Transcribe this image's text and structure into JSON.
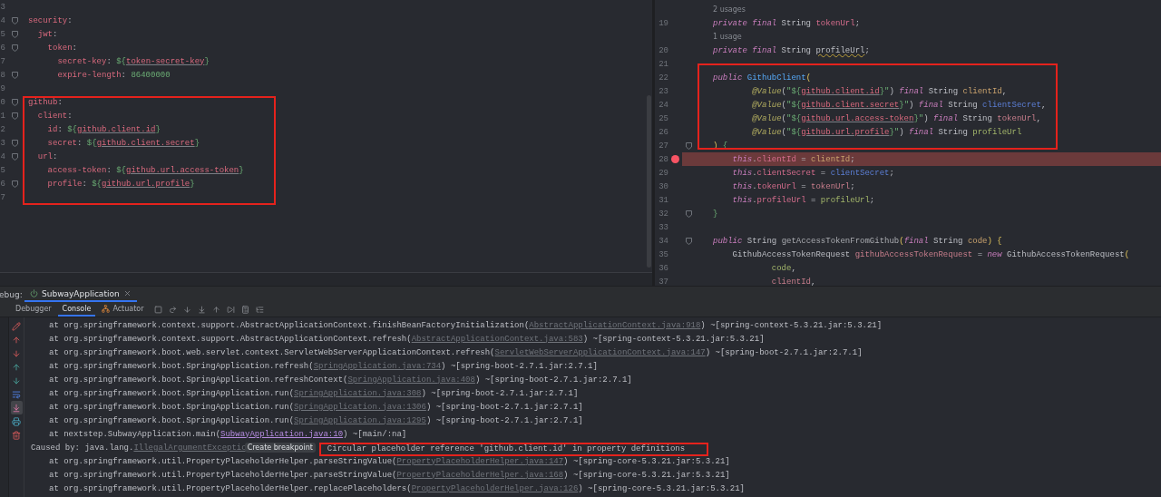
{
  "yaml_editor": {
    "lines": [
      {
        "number": "3",
        "fold": false
      },
      {
        "number": "4",
        "fold": true,
        "tokens": [
          {
            "text": "security",
            "kind": "key"
          },
          {
            "text": ":",
            "kind": "punct"
          }
        ],
        "children": [
          {
            "number": "5",
            "fold": true,
            "tokens": [
              {
                "text": "jwt",
                "kind": "key"
              },
              {
                "text": ":",
                "kind": "punct"
              }
            ],
            "children": [
              {
                "number": "6",
                "fold": true,
                "tokens": [
                  {
                    "text": "token",
                    "kind": "key"
                  },
                  {
                    "text": ":",
                    "kind": "punct"
                  }
                ],
                "children": [
                  {
                    "number": "7",
                    "fold": false,
                    "tokens": [
                      {
                        "text": "secret-key",
                        "kind": "key"
                      },
                      {
                        "text": ": ",
                        "kind": "punct"
                      },
                      {
                        "text": "${",
                        "kind": "string"
                      },
                      {
                        "text": "token-secret-key",
                        "kind": "ref"
                      },
                      {
                        "text": "}",
                        "kind": "string"
                      }
                    ]
                  },
                  {
                    "number": "8",
                    "fold": true,
                    "tokens": [
                      {
                        "text": "expire-length",
                        "kind": "key"
                      },
                      {
                        "text": ": ",
                        "kind": "punct"
                      },
                      {
                        "text": "86400000",
                        "kind": "number"
                      }
                    ]
                  }
                ]
              }
            ]
          }
        ]
      },
      {
        "number": "9",
        "fold": false
      },
      {
        "number": "0",
        "fold": true,
        "framed": true,
        "tokens": [
          {
            "text": "github",
            "kind": "key"
          },
          {
            "text": ":",
            "kind": "punct"
          }
        ],
        "children": [
          {
            "number": "1",
            "fold": true,
            "tokens": [
              {
                "text": "client",
                "kind": "key"
              },
              {
                "text": ":",
                "kind": "punct"
              }
            ],
            "children": [
              {
                "number": "2",
                "fold": false,
                "tokens": [
                  {
                    "text": "id",
                    "kind": "key"
                  },
                  {
                    "text": ": ",
                    "kind": "punct"
                  },
                  {
                    "text": "${",
                    "kind": "string"
                  },
                  {
                    "text": "github.client.id",
                    "kind": "ref"
                  },
                  {
                    "text": "}",
                    "kind": "string"
                  }
                ]
              },
              {
                "number": "3",
                "fold": true,
                "tokens": [
                  {
                    "text": "secret",
                    "kind": "key"
                  },
                  {
                    "text": ": ",
                    "kind": "punct"
                  },
                  {
                    "text": "${",
                    "kind": "string"
                  },
                  {
                    "text": "github.client.secret",
                    "kind": "ref"
                  },
                  {
                    "text": "}",
                    "kind": "string"
                  }
                ]
              }
            ]
          },
          {
            "number": "4",
            "fold": true,
            "tokens": [
              {
                "text": "url",
                "kind": "key"
              },
              {
                "text": ":",
                "kind": "punct"
              }
            ],
            "children": [
              {
                "number": "5",
                "fold": false,
                "tokens": [
                  {
                    "text": "access-token",
                    "kind": "key"
                  },
                  {
                    "text": ": ",
                    "kind": "punct"
                  },
                  {
                    "text": "${",
                    "kind": "string"
                  },
                  {
                    "text": "github.url.access-token",
                    "kind": "ref"
                  },
                  {
                    "text": "}",
                    "kind": "string"
                  }
                ]
              },
              {
                "number": "6",
                "fold": true,
                "tokens": [
                  {
                    "text": "profile",
                    "kind": "key"
                  },
                  {
                    "text": ": ",
                    "kind": "punct"
                  },
                  {
                    "text": "${",
                    "kind": "string"
                  },
                  {
                    "text": "github.url.profile",
                    "kind": "ref"
                  },
                  {
                    "text": "}",
                    "kind": "string"
                  }
                ]
              }
            ]
          },
          {
            "number": "7",
            "fold": false
          }
        ]
      }
    ]
  },
  "java_editor": {
    "lines": [
      {
        "kind": "hint",
        "text": "2 usages"
      },
      {
        "kind": "code",
        "number": "19",
        "fold": false,
        "breakpoint": false,
        "tokens": [
          {
            "text": "private",
            "kind": "keyword"
          },
          {
            "text": " final",
            "kind": "keyword"
          },
          {
            "text": " String ",
            "kind": "type"
          },
          {
            "text": "tokenUrl",
            "kind": "field"
          },
          {
            "text": ";",
            "kind": "punct"
          }
        ]
      },
      {
        "kind": "hint",
        "text": "1 usage"
      },
      {
        "kind": "code",
        "number": "20",
        "fold": false,
        "breakpoint": false,
        "tokens": [
          {
            "text": "private",
            "kind": "keyword"
          },
          {
            "text": " final",
            "kind": "keyword"
          },
          {
            "text": " String ",
            "kind": "type"
          },
          {
            "text": "profileUrl",
            "kind": "warn"
          },
          {
            "text": ";",
            "kind": "punct"
          }
        ]
      },
      {
        "kind": "code",
        "number": "21",
        "fold": false,
        "breakpoint": false
      },
      {
        "kind": "code",
        "number": "22",
        "fold": false,
        "breakpoint": false,
        "framed": true,
        "tokens": [
          {
            "text": "public",
            "kind": "keyword"
          },
          {
            "text": " GithubClient",
            "kind": "func"
          },
          {
            "text": "(",
            "kind": "bracket"
          }
        ],
        "children": [
          {
            "kind": "code",
            "number": "23",
            "fold": false,
            "breakpoint": false,
            "tokens": [
              {
                "text": "@Value",
                "kind": "annotation"
              },
              {
                "text": "(",
                "kind": "punct"
              },
              {
                "text": "\"${",
                "kind": "string"
              },
              {
                "text": "github.client.id",
                "kind": "ref"
              },
              {
                "text": "}\"",
                "kind": "string"
              },
              {
                "text": ") ",
                "kind": "punct"
              },
              {
                "text": "final",
                "kind": "keyword"
              },
              {
                "text": " String ",
                "kind": "type"
              },
              {
                "text": "clientId",
                "kind": "ident1"
              },
              {
                "text": ",",
                "kind": "punct"
              }
            ]
          },
          {
            "kind": "code",
            "number": "24",
            "fold": false,
            "breakpoint": false,
            "tokens": [
              {
                "text": "@Value",
                "kind": "annotation"
              },
              {
                "text": "(",
                "kind": "punct"
              },
              {
                "text": "\"${",
                "kind": "string"
              },
              {
                "text": "github.client.secret",
                "kind": "ref"
              },
              {
                "text": "}\"",
                "kind": "string"
              },
              {
                "text": ") ",
                "kind": "punct"
              },
              {
                "text": "final",
                "kind": "keyword"
              },
              {
                "text": " String ",
                "kind": "type"
              },
              {
                "text": "clientSecret",
                "kind": "ident2"
              },
              {
                "text": ",",
                "kind": "punct"
              }
            ]
          },
          {
            "kind": "code",
            "number": "25",
            "fold": false,
            "breakpoint": false,
            "tokens": [
              {
                "text": "@Value",
                "kind": "annotation"
              },
              {
                "text": "(",
                "kind": "punct"
              },
              {
                "text": "\"${",
                "kind": "string"
              },
              {
                "text": "github.url.access-token",
                "kind": "ref"
              },
              {
                "text": "}\"",
                "kind": "string"
              },
              {
                "text": ") ",
                "kind": "punct"
              },
              {
                "text": "final",
                "kind": "keyword"
              },
              {
                "text": " String ",
                "kind": "type"
              },
              {
                "text": "tokenUrl",
                "kind": "ident3"
              },
              {
                "text": ",",
                "kind": "punct"
              }
            ]
          },
          {
            "kind": "code",
            "number": "26",
            "fold": false,
            "breakpoint": false,
            "tokens": [
              {
                "text": "@Value",
                "kind": "annotation"
              },
              {
                "text": "(",
                "kind": "punct"
              },
              {
                "text": "\"${",
                "kind": "string"
              },
              {
                "text": "github.url.profile",
                "kind": "ref"
              },
              {
                "text": "}\"",
                "kind": "string"
              },
              {
                "text": ") ",
                "kind": "punct"
              },
              {
                "text": "final",
                "kind": "keyword"
              },
              {
                "text": " String ",
                "kind": "type"
              },
              {
                "text": "profileUrl",
                "kind": "ident4"
              }
            ]
          }
        ]
      },
      {
        "kind": "code",
        "number": "27",
        "fold": true,
        "breakpoint": false,
        "tokens": [
          {
            "text": ")",
            "kind": "bracket"
          },
          {
            "text": " {",
            "kind": "brace"
          }
        ],
        "children": [
          {
            "kind": "code",
            "number": "28",
            "fold": false,
            "breakpoint": true,
            "tokens": [
              {
                "text": "this",
                "kind": "keyword"
              },
              {
                "text": ".",
                "kind": "punct"
              },
              {
                "text": "clientId",
                "kind": "field"
              },
              {
                "text": " = ",
                "kind": "punct"
              },
              {
                "text": "clientId",
                "kind": "ident1"
              },
              {
                "text": ";",
                "kind": "punct"
              }
            ]
          },
          {
            "kind": "code",
            "number": "29",
            "fold": false,
            "breakpoint": false,
            "tokens": [
              {
                "text": "this",
                "kind": "keyword"
              },
              {
                "text": ".",
                "kind": "punct"
              },
              {
                "text": "clientSecret",
                "kind": "field"
              },
              {
                "text": " = ",
                "kind": "punct"
              },
              {
                "text": "clientSecret",
                "kind": "ident2"
              },
              {
                "text": ";",
                "kind": "punct"
              }
            ]
          },
          {
            "kind": "code",
            "number": "30",
            "fold": false,
            "breakpoint": false,
            "tokens": [
              {
                "text": "this",
                "kind": "keyword"
              },
              {
                "text": ".",
                "kind": "punct"
              },
              {
                "text": "tokenUrl",
                "kind": "field"
              },
              {
                "text": " = ",
                "kind": "punct"
              },
              {
                "text": "tokenUrl",
                "kind": "ident3"
              },
              {
                "text": ";",
                "kind": "punct"
              }
            ]
          },
          {
            "kind": "code",
            "number": "31",
            "fold": false,
            "breakpoint": false,
            "tokens": [
              {
                "text": "this",
                "kind": "keyword"
              },
              {
                "text": ".",
                "kind": "punct"
              },
              {
                "text": "profileUrl",
                "kind": "field"
              },
              {
                "text": " = ",
                "kind": "punct"
              },
              {
                "text": "profileUrl",
                "kind": "ident4"
              },
              {
                "text": ";",
                "kind": "punct"
              }
            ]
          }
        ]
      },
      {
        "kind": "code",
        "number": "32",
        "fold": true,
        "breakpoint": false,
        "tokens": [
          {
            "text": "}",
            "kind": "brace"
          }
        ]
      },
      {
        "kind": "code",
        "number": "33",
        "fold": false,
        "breakpoint": false
      },
      {
        "kind": "code",
        "number": "34",
        "fold": true,
        "breakpoint": false,
        "tokens": [
          {
            "text": "public",
            "kind": "keyword"
          },
          {
            "text": " String ",
            "kind": "type"
          },
          {
            "text": "getAccessTokenFromGithub",
            "kind": "method"
          },
          {
            "text": "(",
            "kind": "bracket"
          },
          {
            "text": "final",
            "kind": "keyword"
          },
          {
            "text": " String ",
            "kind": "type"
          },
          {
            "text": "code",
            "kind": "ident1"
          },
          {
            "text": ")",
            "kind": "bracket"
          },
          {
            "text": " {",
            "kind": "brace2"
          }
        ],
        "children": [
          {
            "kind": "code",
            "number": "35",
            "fold": false,
            "breakpoint": false,
            "tokens": [
              {
                "text": "GithubAccessTokenRequest ",
                "kind": "type"
              },
              {
                "text": "githubAccessTokenRequest",
                "kind": "ident3"
              },
              {
                "text": " = ",
                "kind": "punct"
              },
              {
                "text": "new",
                "kind": "keyword"
              },
              {
                "text": " GithubAccessTokenRequest",
                "kind": "type"
              },
              {
                "text": "(",
                "kind": "bracket"
              }
            ],
            "children": [
              {
                "kind": "code",
                "number": "36",
                "fold": false,
                "breakpoint": false,
                "tokens": [
                  {
                    "text": "code",
                    "kind": "ident4"
                  },
                  {
                    "text": ",",
                    "kind": "punct"
                  }
                ]
              },
              {
                "kind": "code",
                "number": "37",
                "fold": false,
                "breakpoint": false,
                "tokens": [
                  {
                    "text": "clientId",
                    "kind": "ident3"
                  },
                  {
                    "text": ",",
                    "kind": "punct"
                  }
                ]
              }
            ]
          }
        ]
      }
    ]
  },
  "debug_panel": {
    "label": "ebug:",
    "tabs": [
      {
        "label": "SubwayApplication",
        "selected": true
      }
    ],
    "subtabs": [
      {
        "label": "Debugger",
        "selected": false
      },
      {
        "label": "Console",
        "selected": true
      },
      {
        "label": "Actuator",
        "selected": false
      }
    ],
    "console_lines": [
      {
        "kind": "frame",
        "tokens": [
          {
            "text": "at org.springframework.context.support.AbstractApplicationContext.finishBeanFactoryInitialization(",
            "kind": "plain"
          },
          {
            "text": "AbstractApplicationContext.java:918",
            "kind": "link"
          },
          {
            "text": ") ~[spring-context-5.3.21.jar:5.3.21]",
            "kind": "plain"
          }
        ]
      },
      {
        "kind": "frame",
        "tokens": [
          {
            "text": "at org.springframework.context.support.AbstractApplicationContext.refresh(",
            "kind": "plain"
          },
          {
            "text": "AbstractApplicationContext.java:583",
            "kind": "link"
          },
          {
            "text": ") ~[spring-context-5.3.21.jar:5.3.21]",
            "kind": "plain"
          }
        ]
      },
      {
        "kind": "frame",
        "tokens": [
          {
            "text": "at org.springframework.boot.web.servlet.context.ServletWebServerApplicationContext.refresh(",
            "kind": "plain"
          },
          {
            "text": "ServletWebServerApplicationContext.java:147",
            "kind": "link"
          },
          {
            "text": ") ~[spring-boot-2.7.1.jar:2.7.1]",
            "kind": "plain"
          }
        ]
      },
      {
        "kind": "frame",
        "tokens": [
          {
            "text": "at org.springframework.boot.SpringApplication.refresh(",
            "kind": "plain"
          },
          {
            "text": "SpringApplication.java:734",
            "kind": "link"
          },
          {
            "text": ") ~[spring-boot-2.7.1.jar:2.7.1]",
            "kind": "plain"
          }
        ]
      },
      {
        "kind": "frame",
        "tokens": [
          {
            "text": "at org.springframework.boot.SpringApplication.refreshContext(",
            "kind": "plain"
          },
          {
            "text": "SpringApplication.java:408",
            "kind": "link"
          },
          {
            "text": ") ~[spring-boot-2.7.1.jar:2.7.1]",
            "kind": "plain"
          }
        ]
      },
      {
        "kind": "frame",
        "tokens": [
          {
            "text": "at org.springframework.boot.SpringApplication.run(",
            "kind": "plain"
          },
          {
            "text": "SpringApplication.java:308",
            "kind": "link"
          },
          {
            "text": ") ~[spring-boot-2.7.1.jar:2.7.1]",
            "kind": "plain"
          }
        ]
      },
      {
        "kind": "frame",
        "tokens": [
          {
            "text": "at org.springframework.boot.SpringApplication.run(",
            "kind": "plain"
          },
          {
            "text": "SpringApplication.java:1306",
            "kind": "link"
          },
          {
            "text": ") ~[spring-boot-2.7.1.jar:2.7.1]",
            "kind": "plain"
          }
        ]
      },
      {
        "kind": "frame",
        "tokens": [
          {
            "text": "at org.springframework.boot.SpringApplication.run(",
            "kind": "plain"
          },
          {
            "text": "SpringApplication.java:1295",
            "kind": "link"
          },
          {
            "text": ") ~[spring-boot-2.7.1.jar:2.7.1]",
            "kind": "plain"
          }
        ]
      },
      {
        "kind": "frame",
        "tokens": [
          {
            "text": "at nextstep.SubwayApplication.main(",
            "kind": "plain"
          },
          {
            "text": "SubwayApplication.java:10",
            "kind": "app-link"
          },
          {
            "text": ") ~[main/:na]",
            "kind": "plain"
          }
        ]
      },
      {
        "kind": "cause",
        "tokens": [
          {
            "text": "Caused by: java.lang.",
            "kind": "plain"
          },
          {
            "text": "IllegalArgumentExceptio",
            "kind": "link"
          },
          {
            "text": "Create breakpoint",
            "kind": "tooltip"
          },
          {
            "text": "Circular placeholder reference 'github.client.id' in property definitions",
            "kind": "message"
          }
        ]
      },
      {
        "kind": "frame",
        "tokens": [
          {
            "text": "at org.springframework.util.PropertyPlaceholderHelper.parseStringValue(",
            "kind": "plain"
          },
          {
            "text": "PropertyPlaceholderHelper.java:147",
            "kind": "link"
          },
          {
            "text": ") ~[spring-core-5.3.21.jar:5.3.21]",
            "kind": "plain"
          }
        ]
      },
      {
        "kind": "frame",
        "tokens": [
          {
            "text": "at org.springframework.util.PropertyPlaceholderHelper.parseStringValue(",
            "kind": "plain"
          },
          {
            "text": "PropertyPlaceholderHelper.java:168",
            "kind": "link"
          },
          {
            "text": ") ~[spring-core-5.3.21.jar:5.3.21]",
            "kind": "plain"
          }
        ]
      },
      {
        "kind": "frame",
        "tokens": [
          {
            "text": "at org.springframework.util.PropertyPlaceholderHelper.replacePlaceholders(",
            "kind": "plain"
          },
          {
            "text": "PropertyPlaceholderHelper.java:126",
            "kind": "link"
          },
          {
            "text": ") ~[spring-core-5.3.21.jar:5.3.21]",
            "kind": "plain"
          }
        ]
      }
    ]
  }
}
